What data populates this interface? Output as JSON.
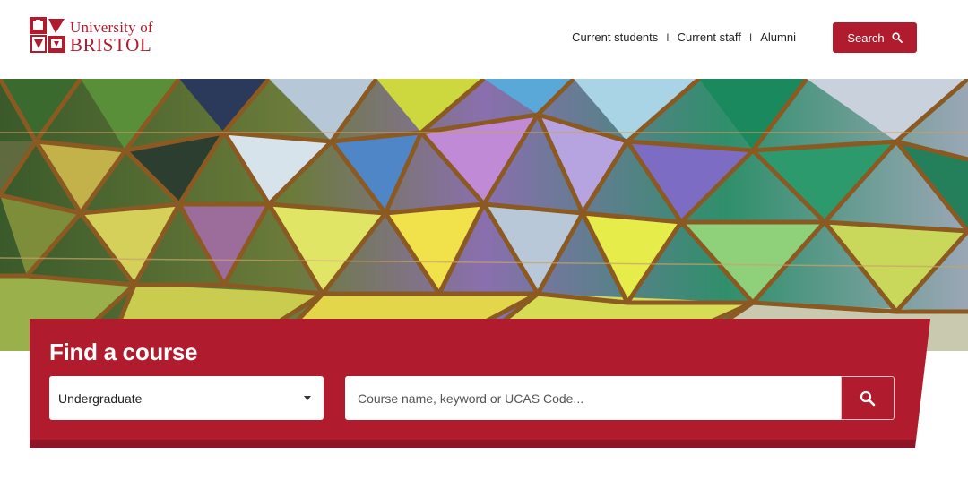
{
  "header": {
    "logo": {
      "line1": "University of",
      "line2": "BRISTOL",
      "icon": "university-crest-icon"
    },
    "links": [
      {
        "label": "Current students"
      },
      {
        "label": "Current staff"
      },
      {
        "label": "Alumni"
      }
    ],
    "link_separator": "I",
    "search_button": {
      "label": "Search",
      "icon": "search-icon"
    }
  },
  "hero": {
    "image": "stained-glass-geodesic-dome"
  },
  "course_finder": {
    "title": "Find a course",
    "level_select": {
      "selected": "Undergraduate",
      "icon": "caret-down-icon"
    },
    "search_input": {
      "placeholder": "Course name, keyword or UCAS Code...",
      "value": ""
    },
    "submit_icon": "search-icon"
  },
  "colors": {
    "brand_red": "#b01c2e",
    "panel_shadow": "#8f1526",
    "white": "#ffffff"
  }
}
